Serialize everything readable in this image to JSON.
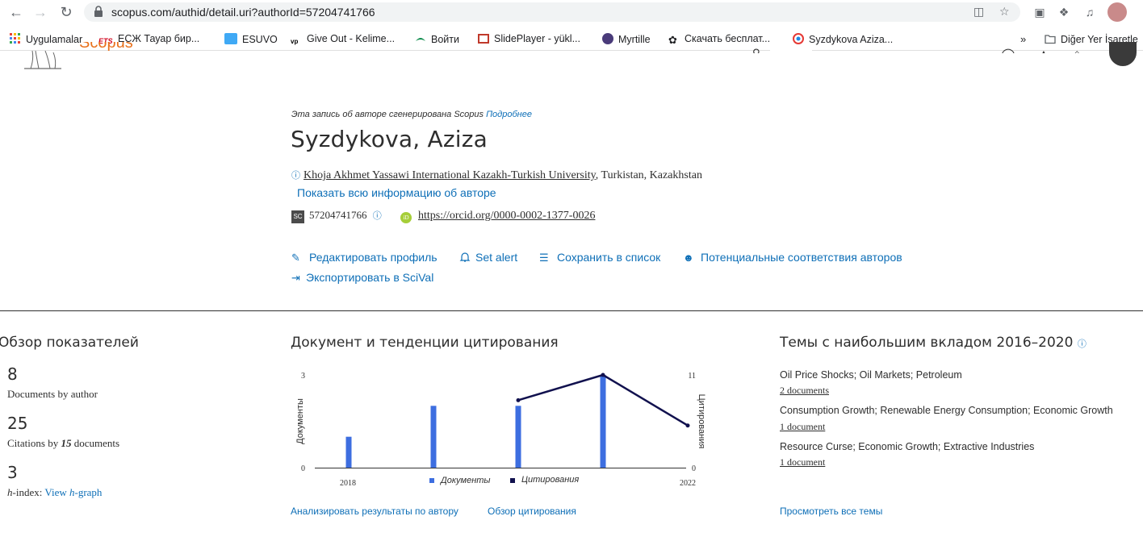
{
  "browser": {
    "url": "scopus.com/authid/detail.uri?authorId=57204741766",
    "bookmarks": [
      {
        "label": "Uygulamalar",
        "icon": "apps-grid-icon"
      },
      {
        "label": "ЕСЖ Тауар бир...",
        "icon": "ets-icon"
      },
      {
        "label": "ESUVO",
        "icon": "esuvo-icon"
      },
      {
        "label": "Give Out - Kelime...",
        "icon": "vp-icon"
      },
      {
        "label": "Войти",
        "icon": "login-icon"
      },
      {
        "label": "SlidePlayer - yükl...",
        "icon": "slideplayer-icon"
      },
      {
        "label": "Myrtille",
        "icon": "myrtille-icon"
      },
      {
        "label": "Скачать бесплат...",
        "icon": "paw-icon"
      },
      {
        "label": "Syzdykova Aziza...",
        "icon": "orcid-icon"
      }
    ],
    "other_bookmarks": "Diğer Yer İşaretle"
  },
  "header": {
    "logo": "Scopus"
  },
  "author": {
    "generated_note": "Эта запись об авторе сгенерирована",
    "generated_source": "Scopus",
    "more_link": "Подробнее",
    "name": "Syzdykova, Aziza",
    "affiliation": "Khoja Akhmet Yassawi International Kazakh-Turkish University",
    "location": ", Turkistan, Kazakhstan",
    "show_all": "Показать всю информацию об авторе",
    "scopus_badge": "SC",
    "scopus_id": "57204741766",
    "orcid_badge": "iD",
    "orcid_url": "https://orcid.org/0000-0002-1377-0026"
  },
  "actions": {
    "edit_profile": "Редактировать профиль",
    "set_alert": "Set alert",
    "save_to_list": "Сохранить в список",
    "potential_matches": "Потенциальные соответствия авторов",
    "export_scival": "Экспортировать в SciVal"
  },
  "metrics": {
    "title": "Обзор показателей",
    "documents_count": "8",
    "documents_label": "Documents by author",
    "citations_count": "25",
    "citations_label_prefix": "Citations by ",
    "citations_docs": "15",
    "citations_label_suffix": " documents",
    "hindex_count": "3",
    "hindex_label_h": "h",
    "hindex_label_rest": "-index: ",
    "view_hgraph_prefix": "View ",
    "view_hgraph_h": "h",
    "view_hgraph_suffix": "-graph"
  },
  "trends": {
    "title": "Документ и тенденции цитирования",
    "analyze_link": "Анализировать результаты по автору",
    "citation_overview_link": "Обзор цитирования"
  },
  "chart_data": {
    "type": "bar",
    "x": [
      2018,
      2019,
      2020,
      2021,
      2022
    ],
    "x_tick_labels": [
      "2018",
      "2022"
    ],
    "series": [
      {
        "name": "Документы",
        "type": "bar",
        "axis": "left",
        "values": [
          1,
          2,
          2,
          3,
          null
        ],
        "color": "#3d6ee0"
      },
      {
        "name": "Цитирования",
        "type": "line",
        "axis": "right",
        "values": [
          null,
          null,
          8,
          11,
          5
        ],
        "color": "#11114e"
      }
    ],
    "ylabel_left": "Документы",
    "ylabel_right": "Цитирования",
    "ylim_left": [
      0,
      3
    ],
    "ylim_right": [
      0,
      11
    ],
    "yticks_left": [
      "0",
      "3"
    ],
    "yticks_right": [
      "0",
      "11"
    ],
    "legend_placement": "bottom-center",
    "grid": false
  },
  "topics": {
    "title": "Темы с наибольшим вкладом 2016–2020",
    "items": [
      {
        "title": "Oil Price Shocks; Oil Markets; Petroleum",
        "docs": "2 documents"
      },
      {
        "title": "Consumption Growth; Renewable Energy Consumption; Economic Growth",
        "docs": "1 document"
      },
      {
        "title": "Resource Curse; Economic Growth; Extractive Industries",
        "docs": "1 document"
      }
    ],
    "view_all": "Просмотреть все темы"
  },
  "colors": {
    "link": "#0e6fb7",
    "scopus_orange": "#e9711c",
    "bar": "#3d6ee0",
    "line": "#11114e"
  }
}
